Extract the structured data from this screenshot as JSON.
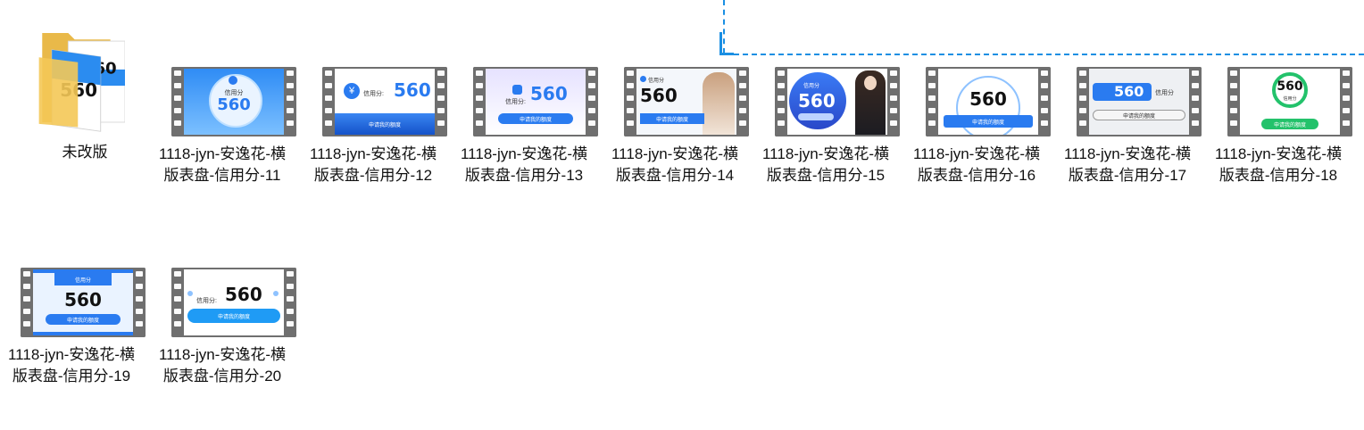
{
  "folder": {
    "label": "未改版"
  },
  "files": [
    {
      "label": "1118-jyn-安逸花-横版表盘-信用分-11",
      "score": "560",
      "caption": "信用分",
      "button": ""
    },
    {
      "label": "1118-jyn-安逸花-横版表盘-信用分-12",
      "score": "560",
      "caption": "信用分:",
      "button": "申请我的额度"
    },
    {
      "label": "1118-jyn-安逸花-横版表盘-信用分-13",
      "score": "560",
      "caption": "信用分:",
      "button": "申请我的额度"
    },
    {
      "label": "1118-jyn-安逸花-横版表盘-信用分-14",
      "score": "560",
      "caption": "信用分",
      "button": "申请我的额度"
    },
    {
      "label": "1118-jyn-安逸花-横版表盘-信用分-15",
      "score": "560",
      "caption": "信用分",
      "button": "申请我的额度"
    },
    {
      "label": "1118-jyn-安逸花-横版表盘-信用分-16",
      "score": "560",
      "caption": "",
      "button": "申请我的额度"
    },
    {
      "label": "1118-jyn-安逸花-横版表盘-信用分-17",
      "score": "560",
      "caption": "信用分",
      "button": "申请我的额度"
    },
    {
      "label": "1118-jyn-安逸花-横版表盘-信用分-18",
      "score": "560",
      "caption": "信用分",
      "button": "申请我的额度"
    },
    {
      "label": "1118-jyn-安逸花-横版表盘-信用分-19",
      "score": "560",
      "caption": "信用分",
      "button": "申请我的额度"
    },
    {
      "label": "1118-jyn-安逸花-横版表盘-信用分-20",
      "score": "560",
      "caption": "信用分:",
      "button": "申请我的额度"
    }
  ],
  "colors": {
    "accent": "#1a8fe3",
    "brand": "#2a7bf0",
    "green": "#23c26b",
    "film": "#6f6f6f"
  }
}
